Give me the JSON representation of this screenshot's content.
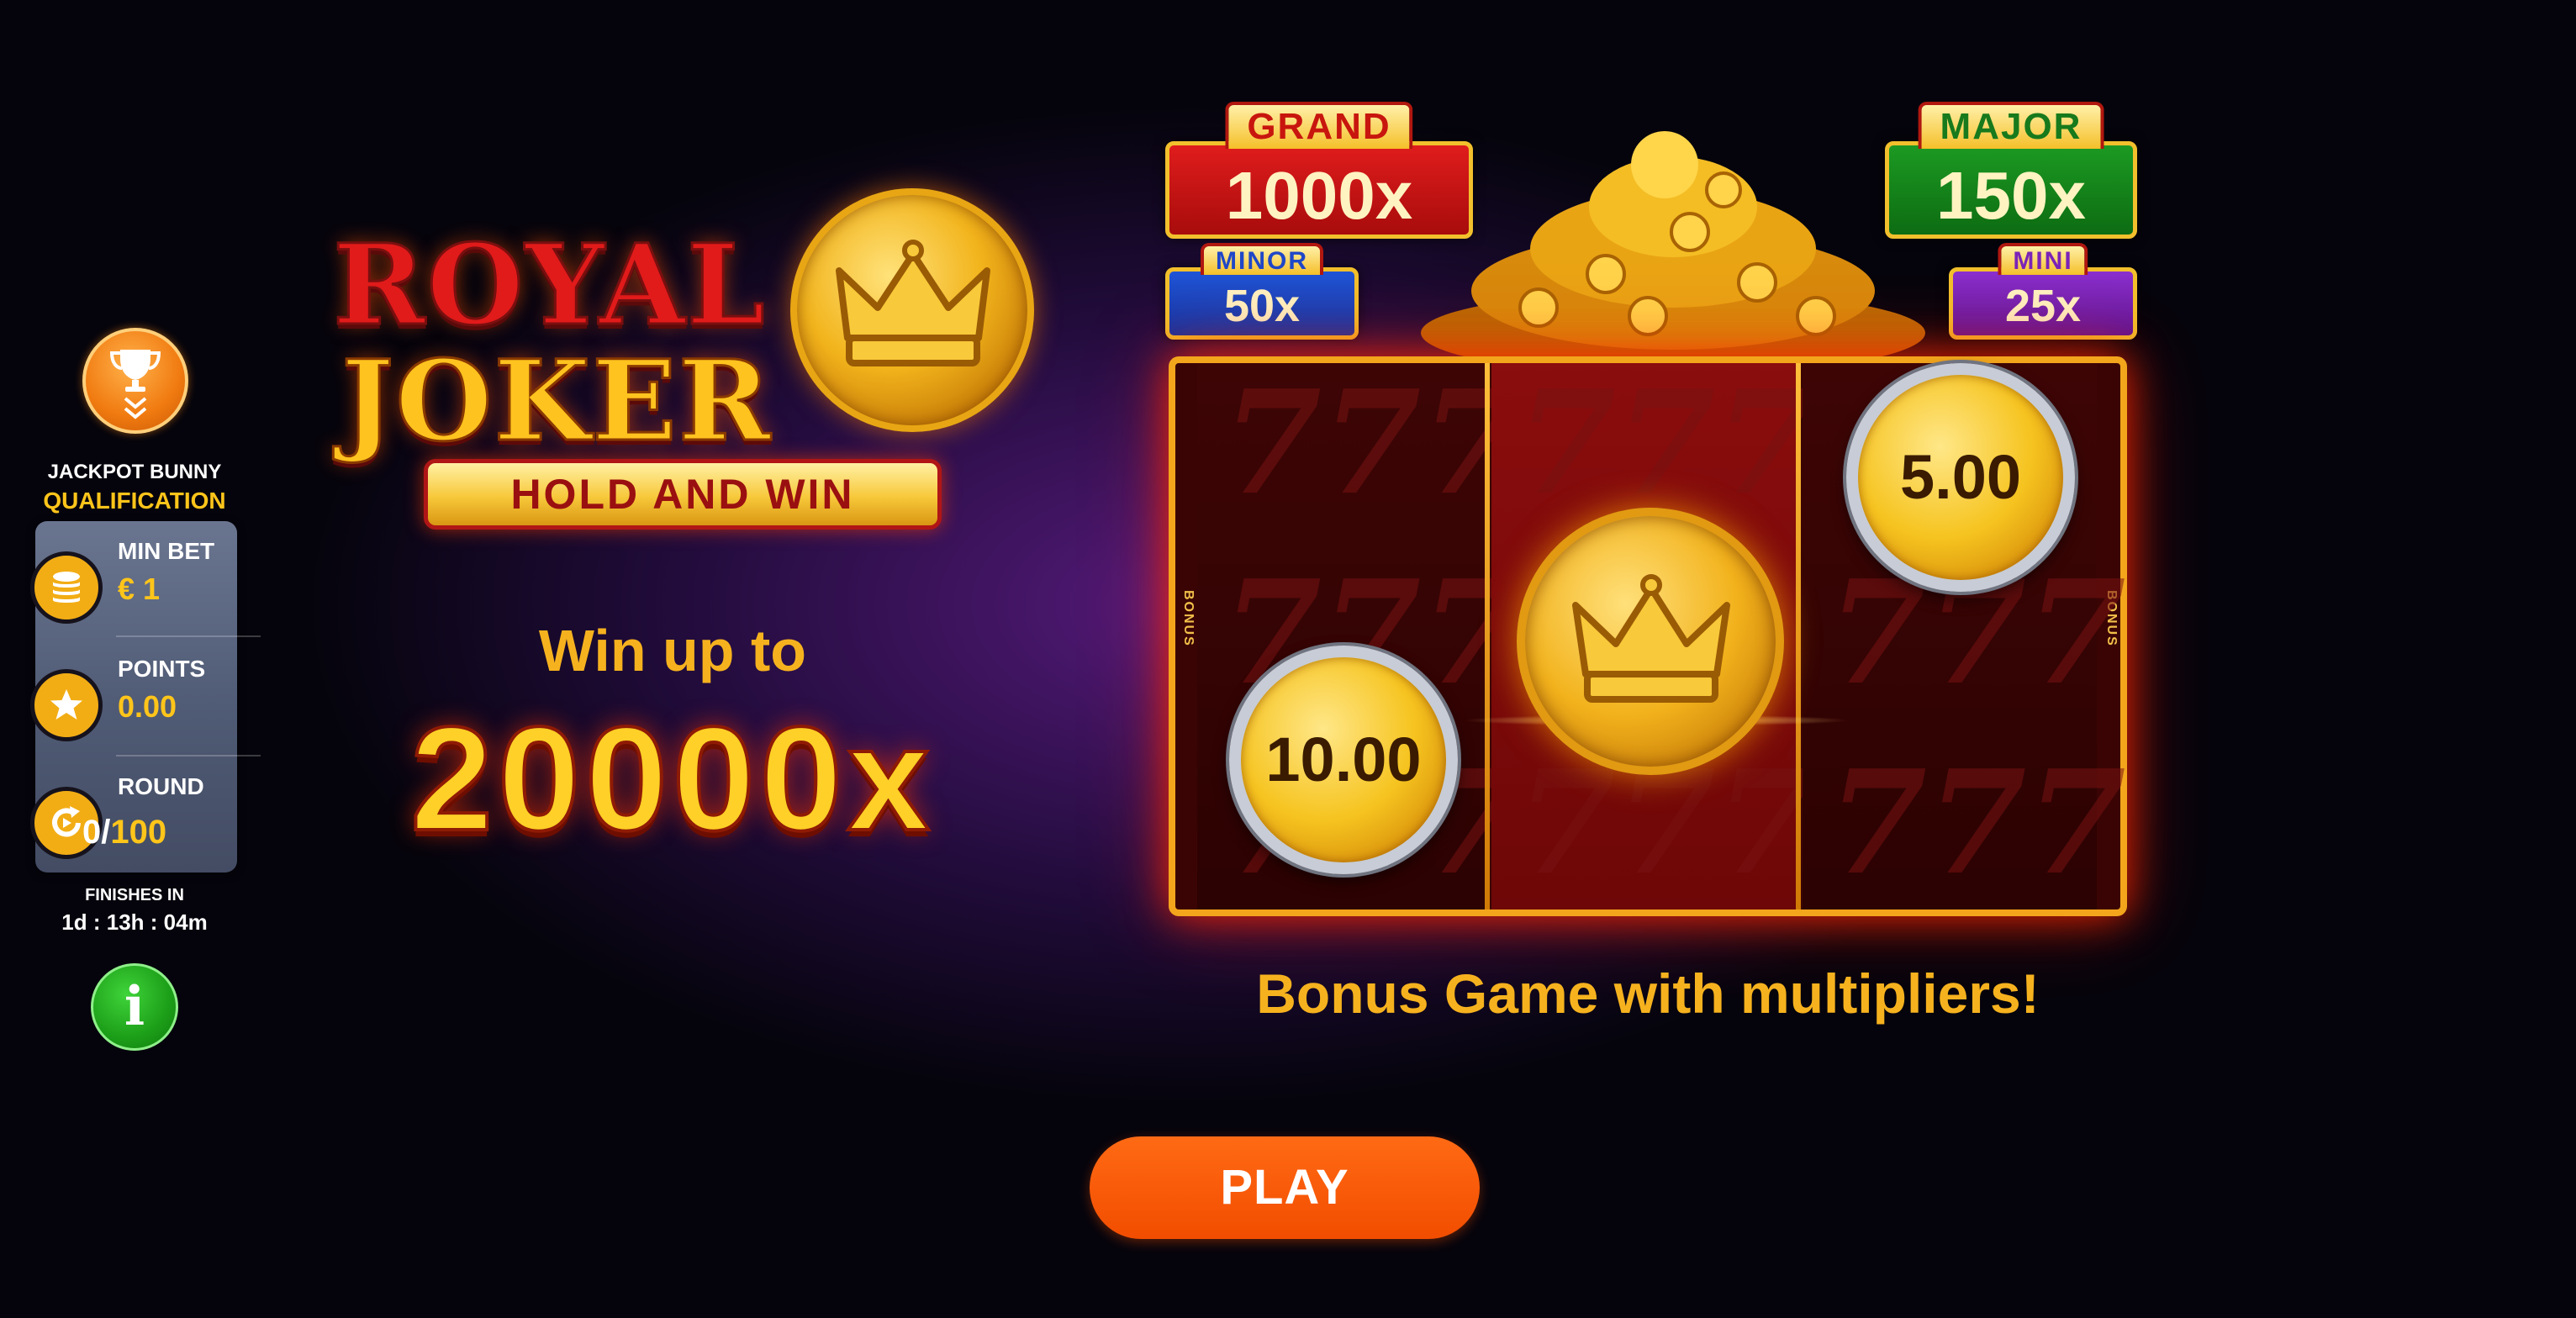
{
  "sidebar": {
    "leaderboard_name": "JACKPOT BUNNY",
    "leaderboard_status": "QUALIFICATION",
    "stats": {
      "min_bet_label": "MIN BET",
      "min_bet_value": "€ 1",
      "points_label": "POINTS",
      "points_value": "0.00",
      "round_label": "ROUND",
      "round_current": "0/",
      "round_total": "100"
    },
    "finishes_label": "FINISHES IN",
    "finishes_time": "1d : 13h : 04m",
    "info_label": "i"
  },
  "logo": {
    "line1": "ROYAL",
    "line2": "JOKER",
    "subtitle": "HOLD AND WIN"
  },
  "promo": {
    "win_up_to": "Win up to",
    "max_multiplier": "20000x",
    "bonus_caption": "Bonus Game with multipliers!"
  },
  "jackpots": {
    "grand": {
      "title": "GRAND",
      "value": "1000x"
    },
    "major": {
      "title": "MAJOR",
      "value": "150x"
    },
    "minor": {
      "title": "MINOR",
      "value": "50x"
    },
    "mini": {
      "title": "MINI",
      "value": "25x"
    }
  },
  "reels": {
    "bonus_label": "BONUS",
    "coin_top_right": "5.00",
    "coin_bottom_left": "10.00",
    "ghost_symbol": "777"
  },
  "actions": {
    "play_label": "PLAY"
  },
  "colors": {
    "accent_gold": "#ffc51a",
    "play_orange": "#f24d00",
    "info_green": "#1c9e18"
  }
}
